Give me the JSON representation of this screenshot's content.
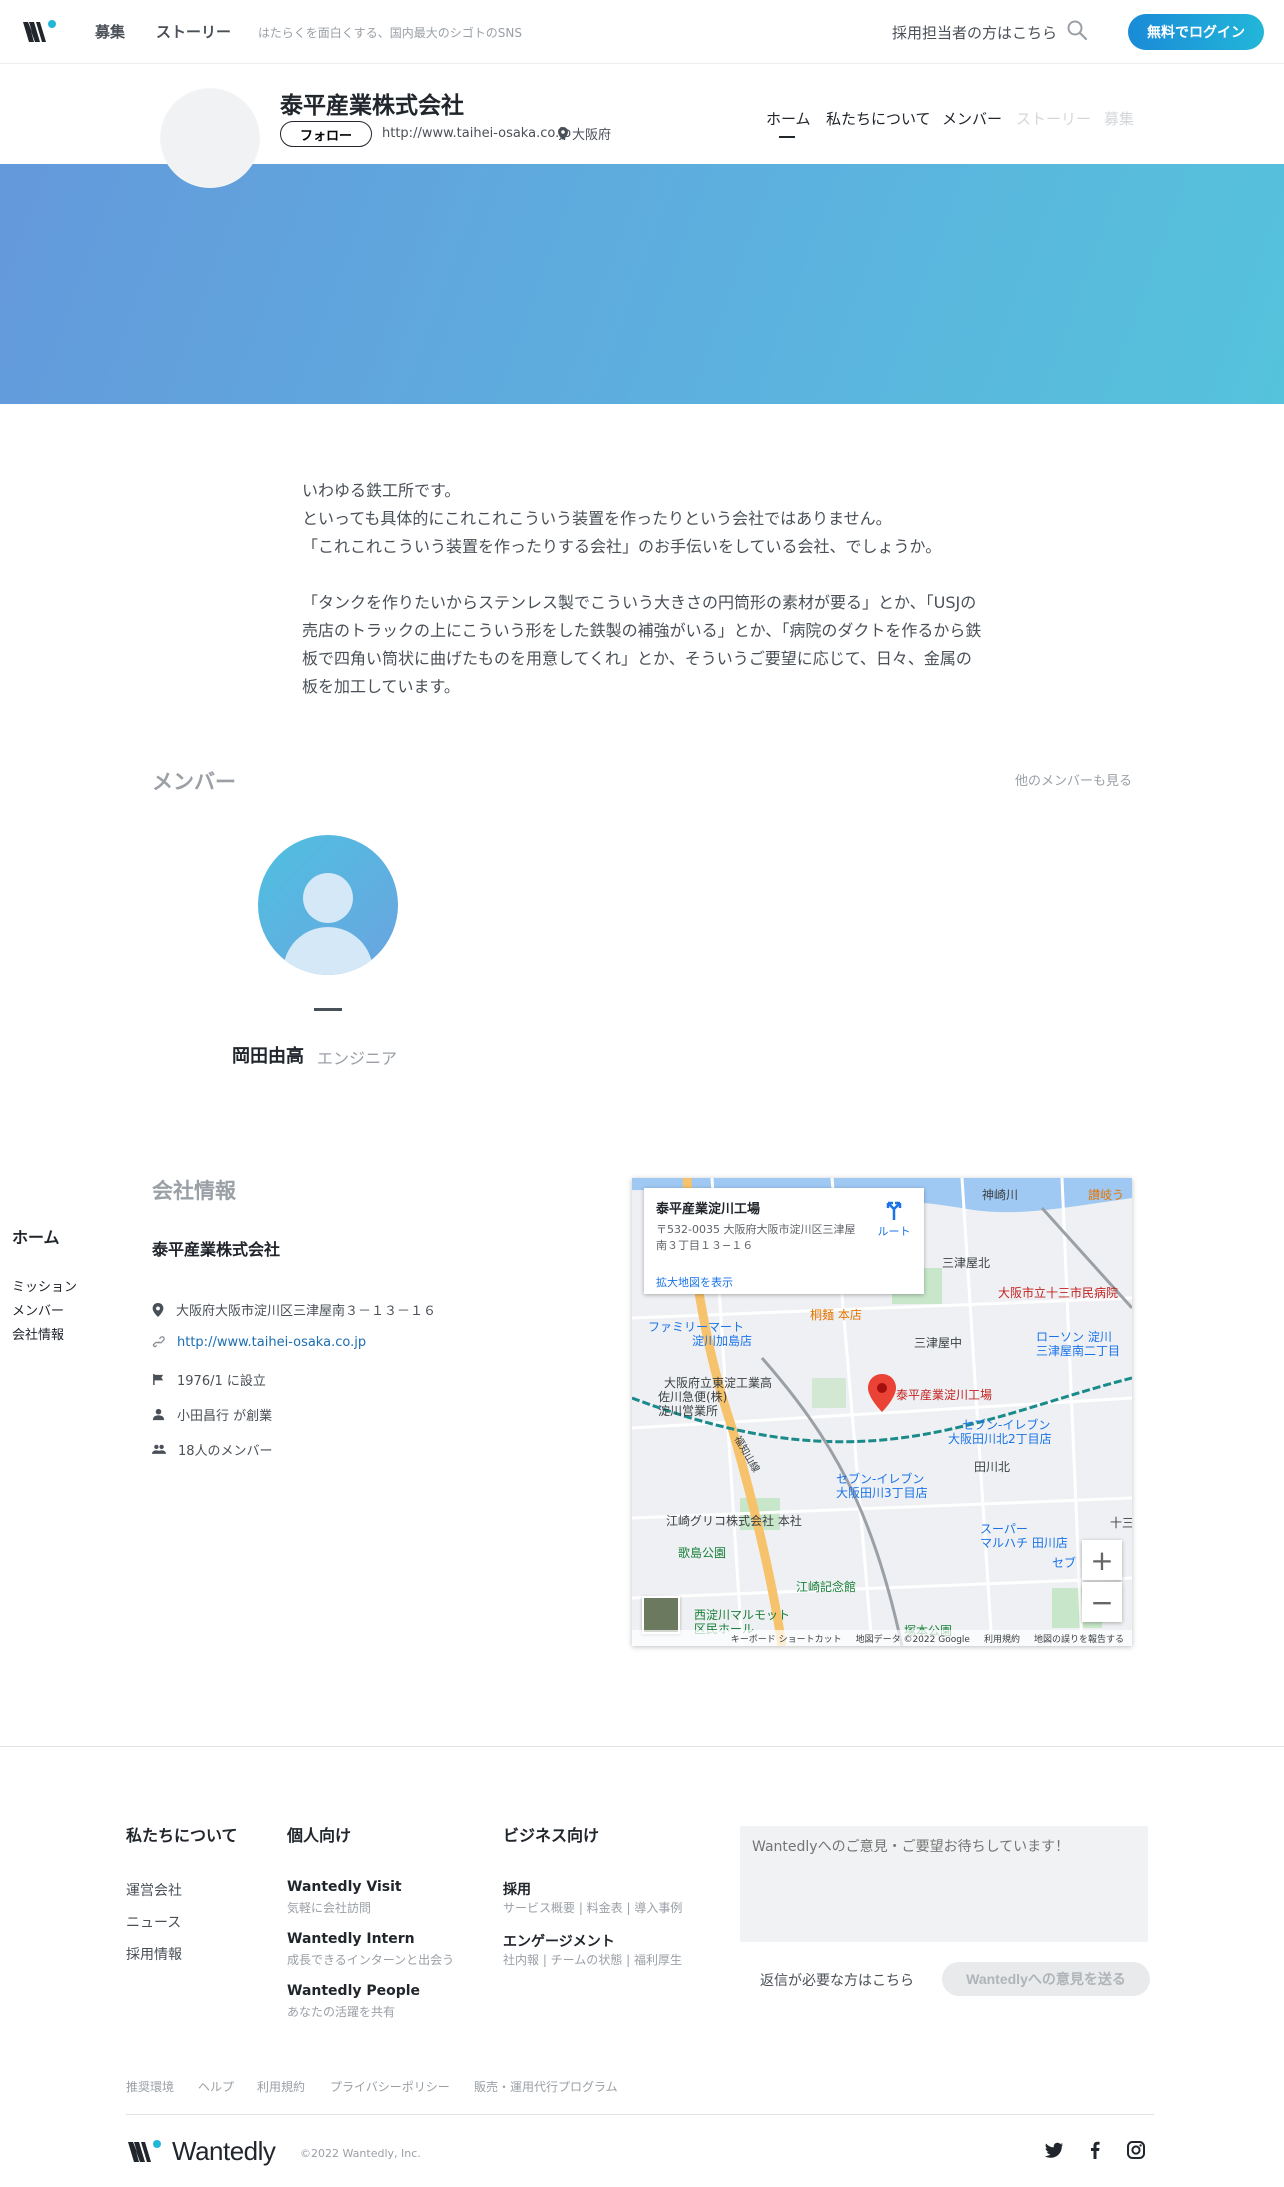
{
  "nav": {
    "items": [
      "募集",
      "ストーリー"
    ],
    "tagline": "はたらくを面白くする、国内最大のシゴトのSNS",
    "recruiter_link": "採用担当者の方はこちら",
    "login_label": "無料でログイン"
  },
  "company": {
    "name": "泰平産業株式会社",
    "follow_label": "フォロー",
    "url": "http://www.taihei-osaka.co.jp",
    "location": "大阪府",
    "tabs": [
      "ホーム",
      "私たちについて",
      "メンバー",
      "ストーリー",
      "募集"
    ],
    "active_tab": "ホーム"
  },
  "description": {
    "para1": "いわゆる鉄工所です。\nといっても具体的にこれこれこういう装置を作ったりという会社ではありません。\n「これこれこういう装置を作ったりする会社」のお手伝いをしている会社、でしょうか。",
    "para2": "「タンクを作りたいからステンレス製でこういう大きさの円筒形の素材が要る」とか、「USJの売店のトラックの上にこういう形をした鉄製の補強がいる」とか、「病院のダクトを作るから鉄板で四角い筒状に曲げたものを用意してくれ」とか、そういうご要望に応じて、日々、金属の板を加工しています。"
  },
  "members": {
    "title": "メンバー",
    "see_more": "他のメンバーも見る",
    "list": [
      {
        "name": "岡田由高",
        "role": "エンジニア"
      }
    ]
  },
  "sidenav": {
    "home": "ホーム",
    "links": [
      "ミッション",
      "メンバー",
      "会社情報"
    ]
  },
  "info": {
    "title": "会社情報",
    "company": "泰平産業株式会社",
    "address": "大阪府大阪市淀川区三津屋南３－１３－１６",
    "url": "http://www.taihei-osaka.co.jp",
    "founded": "1976/1 に設立",
    "founder": "小田昌行 が創業",
    "members": "18人のメンバー"
  },
  "map": {
    "place": "泰平産業淀川工場",
    "address": "〒532-0035 大阪府大阪市淀川区三津屋南３丁目１３−１６",
    "route": "ルート",
    "enlarge": "拡大地図を表示",
    "labels": {
      "kanzakigawa": "神崎川",
      "sanuki": "讃岐う",
      "mitsuya_kita": "三津屋北",
      "jusou_hospital": "大阪市立十三市民病院",
      "kirimen": "桐麺 本店",
      "famima": "ファミリーマート",
      "famima2": "淀川加島店",
      "mitsuya_naka": "三津屋中",
      "lawson": "ローソン 淀川",
      "lawson2": "三津屋南二丁目",
      "school": "大阪府立東淀工業高",
      "sagawa": "佐川急便(株)",
      "sagawa2": "淀川営業所",
      "marker": "泰平産業淀川工場",
      "seven1": "セブン-イレブン",
      "seven1b": "大阪田川北2丁目店",
      "tagawa_kita": "田川北",
      "fukuchiyama": "福知山線",
      "seven2": "セブン-イレブン",
      "seven2b": "大阪田川3丁目店",
      "glico": "江崎グリコ株式会社 本社",
      "super": "スーパー",
      "super2": "マルハチ 田川店",
      "utajima": "歌島公園",
      "ezaki": "江崎記念館",
      "nishiyodo": "西淀川マルモット",
      "nishiyodo2": "区民ホール",
      "tsukamoto": "塚本公園",
      "seven3": "セブ",
      "juso": "十三"
    },
    "footer": [
      "キーボード ショートカット",
      "地図データ ©2022 Google",
      "利用規約",
      "地図の誤りを報告する"
    ]
  },
  "footer": {
    "col1": {
      "title": "私たちについて",
      "links": [
        "運営会社",
        "ニュース",
        "採用情報"
      ]
    },
    "col2": {
      "title": "個人向け",
      "items": [
        {
          "title": "Wantedly Visit",
          "sub": "気軽に会社訪問"
        },
        {
          "title": "Wantedly Intern",
          "sub": "成長できるインターンと出会う"
        },
        {
          "title": "Wantedly People",
          "sub": "あなたの活躍を共有"
        }
      ]
    },
    "col3": {
      "title": "ビジネス向け",
      "items": [
        {
          "title": "採用",
          "sub": "サービス概要 | 料金表 | 導入事例"
        },
        {
          "title": "エンゲージメント",
          "sub": "社内報 | チームの状態 | 福利厚生"
        }
      ]
    },
    "feedback_placeholder": "Wantedlyへのご意見・ご要望お待ちしています！",
    "reply_link": "返信が必要な方はこちら",
    "send_label": "Wantedlyへの意見を送る",
    "bottom_links": [
      "推奨環境",
      "ヘルプ",
      "利用規約",
      "プライバシーポリシー",
      "販売・運用代行プログラム"
    ],
    "brand": "Wantedly",
    "copyright": "©2022 Wantedly, Inc."
  }
}
